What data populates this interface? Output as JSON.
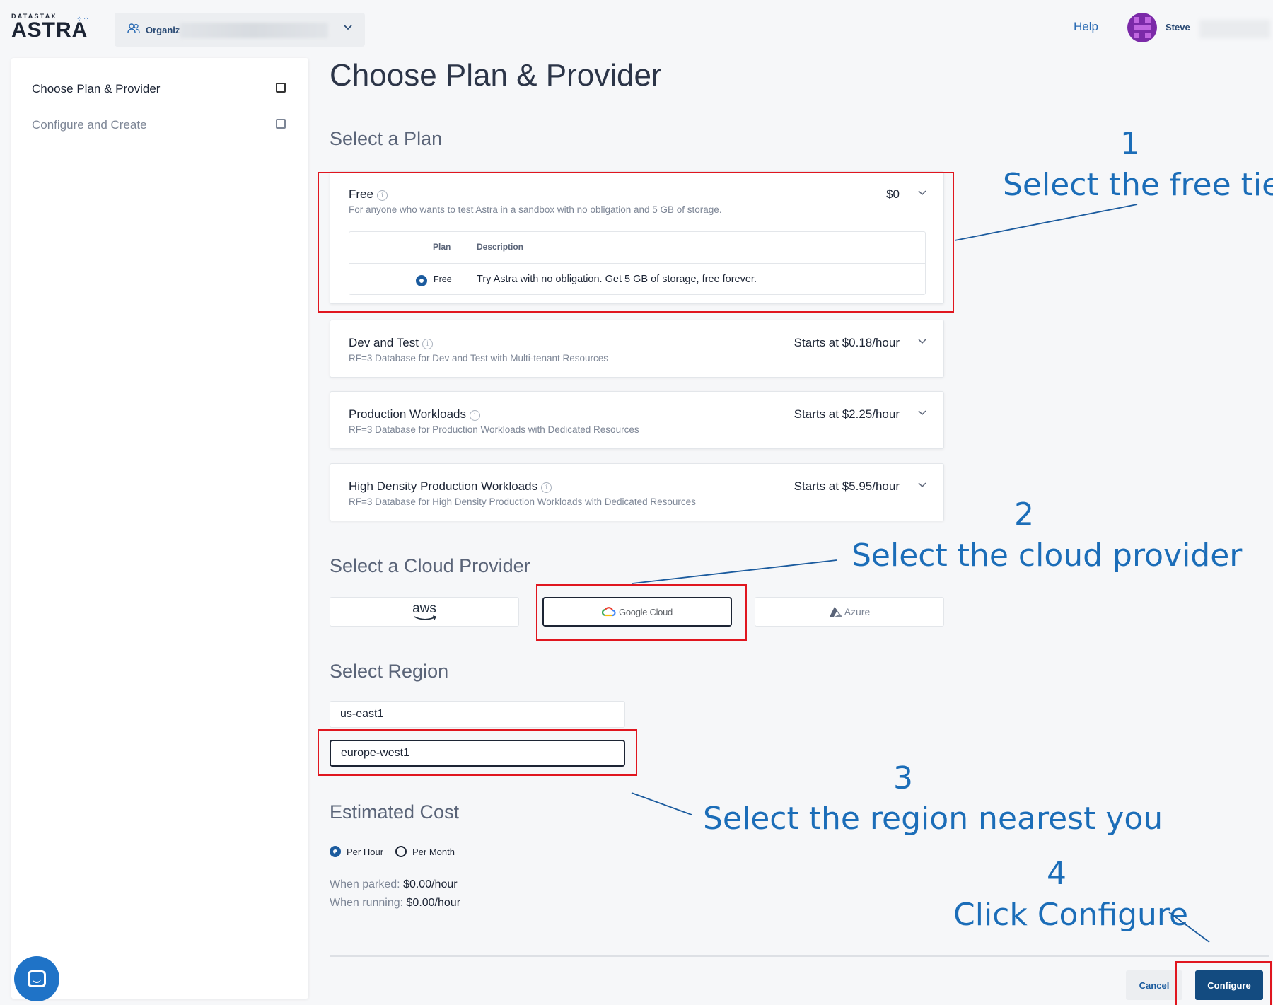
{
  "header": {
    "logo_sub": "DATASTAX",
    "logo_main": "ASTRA",
    "org_label": "Organiz",
    "help": "Help",
    "user_name": "Steve"
  },
  "sidebar": {
    "steps": [
      {
        "label": "Choose Plan & Provider",
        "active": true
      },
      {
        "label": "Configure and Create",
        "active": false
      }
    ]
  },
  "main": {
    "title": "Choose Plan & Provider",
    "plan_section": "Select a Plan",
    "plans": [
      {
        "name": "Free",
        "description": "For anyone who wants to test Astra in a sandbox with no obligation and 5 GB of storage.",
        "price": "$0",
        "expanded": true,
        "table": {
          "headers": [
            "Plan",
            "Description"
          ],
          "rows": [
            {
              "plan": "Free",
              "description": "Try Astra with no obligation. Get 5 GB of storage, free forever.",
              "selected": true
            }
          ]
        }
      },
      {
        "name": "Dev and Test",
        "description": "RF=3 Database for Dev and Test with Multi-tenant Resources",
        "price": "Starts at $0.18/hour",
        "expanded": false
      },
      {
        "name": "Production Workloads",
        "description": "RF=3 Database for Production Workloads with Dedicated Resources",
        "price": "Starts at $2.25/hour",
        "expanded": false
      },
      {
        "name": "High Density Production Workloads",
        "description": "RF=3 Database for High Density Production Workloads with Dedicated Resources",
        "price": "Starts at $5.95/hour",
        "expanded": false
      }
    ],
    "provider_section": "Select a Cloud Provider",
    "providers": [
      {
        "name": "aws",
        "selected": false
      },
      {
        "name": "Google Cloud",
        "selected": true
      },
      {
        "name": "Azure",
        "selected": false
      }
    ],
    "region_section": "Select Region",
    "regions": [
      {
        "name": "us-east1",
        "selected": false
      },
      {
        "name": "europe-west1",
        "selected": true
      }
    ],
    "cost_section": "Estimated Cost",
    "cost_periods": [
      {
        "label": "Per Hour",
        "selected": true
      },
      {
        "label": "Per Month",
        "selected": false
      }
    ],
    "when_parked_label": "When parked:",
    "when_parked_value": "$0.00/hour",
    "when_running_label": "When running:",
    "when_running_value": "$0.00/hour",
    "cancel": "Cancel",
    "configure": "Configure"
  },
  "annotations": [
    {
      "number": "1",
      "text": "Select the free tier"
    },
    {
      "number": "2",
      "text": "Select the cloud provider"
    },
    {
      "number": "3",
      "text": "Select the region nearest you"
    },
    {
      "number": "4",
      "text": "Click Configure"
    }
  ],
  "colors": {
    "accent": "#134b80",
    "annotation_text": "#1b6db8",
    "annotation_box": "#e0161f",
    "page_bg": "#f6f7f9"
  }
}
